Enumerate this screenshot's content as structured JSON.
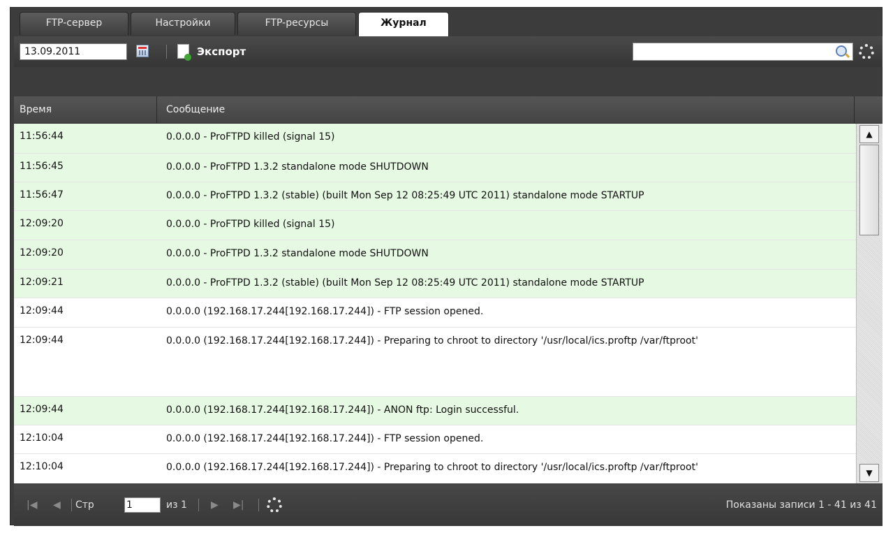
{
  "tabs": [
    {
      "label": "FTP-сервер",
      "active": false
    },
    {
      "label": "Настройки",
      "active": false
    },
    {
      "label": "FTP-ресурсы",
      "active": false
    },
    {
      "label": "Журнал",
      "active": true
    }
  ],
  "toolbar": {
    "date_value": "13.09.2011",
    "export_label": "Экспорт",
    "search_value": ""
  },
  "grid": {
    "columns": [
      "Время",
      "Сообщение"
    ],
    "rows": [
      {
        "time": "11:56:44",
        "message": "0.0.0.0 - ProFTPD killed (signal 15)",
        "highlight": true
      },
      {
        "time": "11:56:45",
        "message": "0.0.0.0 - ProFTPD 1.3.2 standalone mode SHUTDOWN",
        "highlight": true
      },
      {
        "time": "11:56:47",
        "message": "0.0.0.0 - ProFTPD 1.3.2 (stable) (built Mon Sep 12 08:25:49 UTC 2011) standalone mode STARTUP",
        "highlight": true
      },
      {
        "time": "12:09:20",
        "message": "0.0.0.0 - ProFTPD killed (signal 15)",
        "highlight": true
      },
      {
        "time": "12:09:20",
        "message": "0.0.0.0 - ProFTPD 1.3.2 standalone mode SHUTDOWN",
        "highlight": true
      },
      {
        "time": "12:09:21",
        "message": "0.0.0.0 - ProFTPD 1.3.2 (stable) (built Mon Sep 12 08:25:49 UTC 2011) standalone mode STARTUP",
        "highlight": true
      },
      {
        "time": "12:09:44",
        "message": "0.0.0.0 (192.168.17.244[192.168.17.244]) - FTP session opened.",
        "highlight": false
      },
      {
        "time": "12:09:44",
        "message": "0.0.0.0 (192.168.17.244[192.168.17.244]) - Preparing to chroot to directory '/usr/local/ics.proftp /var/ftproot'",
        "highlight": false
      },
      {
        "time": "12:09:44",
        "message": "0.0.0.0 (192.168.17.244[192.168.17.244]) - ANON ftp: Login successful.",
        "highlight": true
      },
      {
        "time": "12:10:04",
        "message": "0.0.0.0 (192.168.17.244[192.168.17.244]) - FTP session opened.",
        "highlight": false
      },
      {
        "time": "12:10:04",
        "message": "0.0.0.0 (192.168.17.244[192.168.17.244]) - Preparing to chroot to directory '/usr/local/ics.proftp /var/ftproot'",
        "highlight": false
      },
      {
        "time": "",
        "message": "",
        "highlight": true
      }
    ]
  },
  "paging": {
    "page_label": "Стр",
    "page_value": "1",
    "of_label": "из 1",
    "status": "Показаны записи 1 - 41 из 41"
  },
  "colors": {
    "highlight_row": "#e6f9e2",
    "frame": "#3c3c3c"
  }
}
